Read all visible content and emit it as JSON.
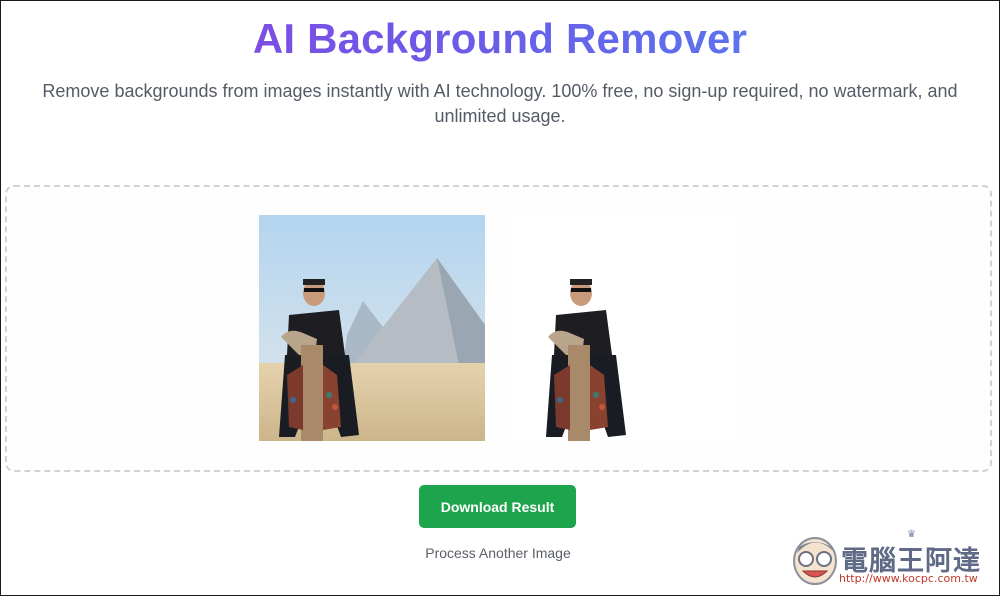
{
  "header": {
    "title": "AI Background Remover",
    "subtitle": "Remove backgrounds from images instantly with AI technology. 100% free, no sign-up required, no watermark, and unlimited usage."
  },
  "preview": {
    "original_alt": "Original image: man riding a camel in front of pyramids",
    "result_alt": "Result image: man riding a camel with background removed"
  },
  "actions": {
    "download_label": "Download Result",
    "process_another_label": "Process Another Image"
  },
  "watermark": {
    "brand": "電腦王阿達",
    "url": "http://www.kocpc.com.tw"
  },
  "colors": {
    "title_gradient_start": "#7c4ee4",
    "title_gradient_end": "#5b73ee",
    "download_button": "#1ea44c",
    "subtitle_text": "#555b66",
    "dropzone_border": "#cfd3d8"
  }
}
